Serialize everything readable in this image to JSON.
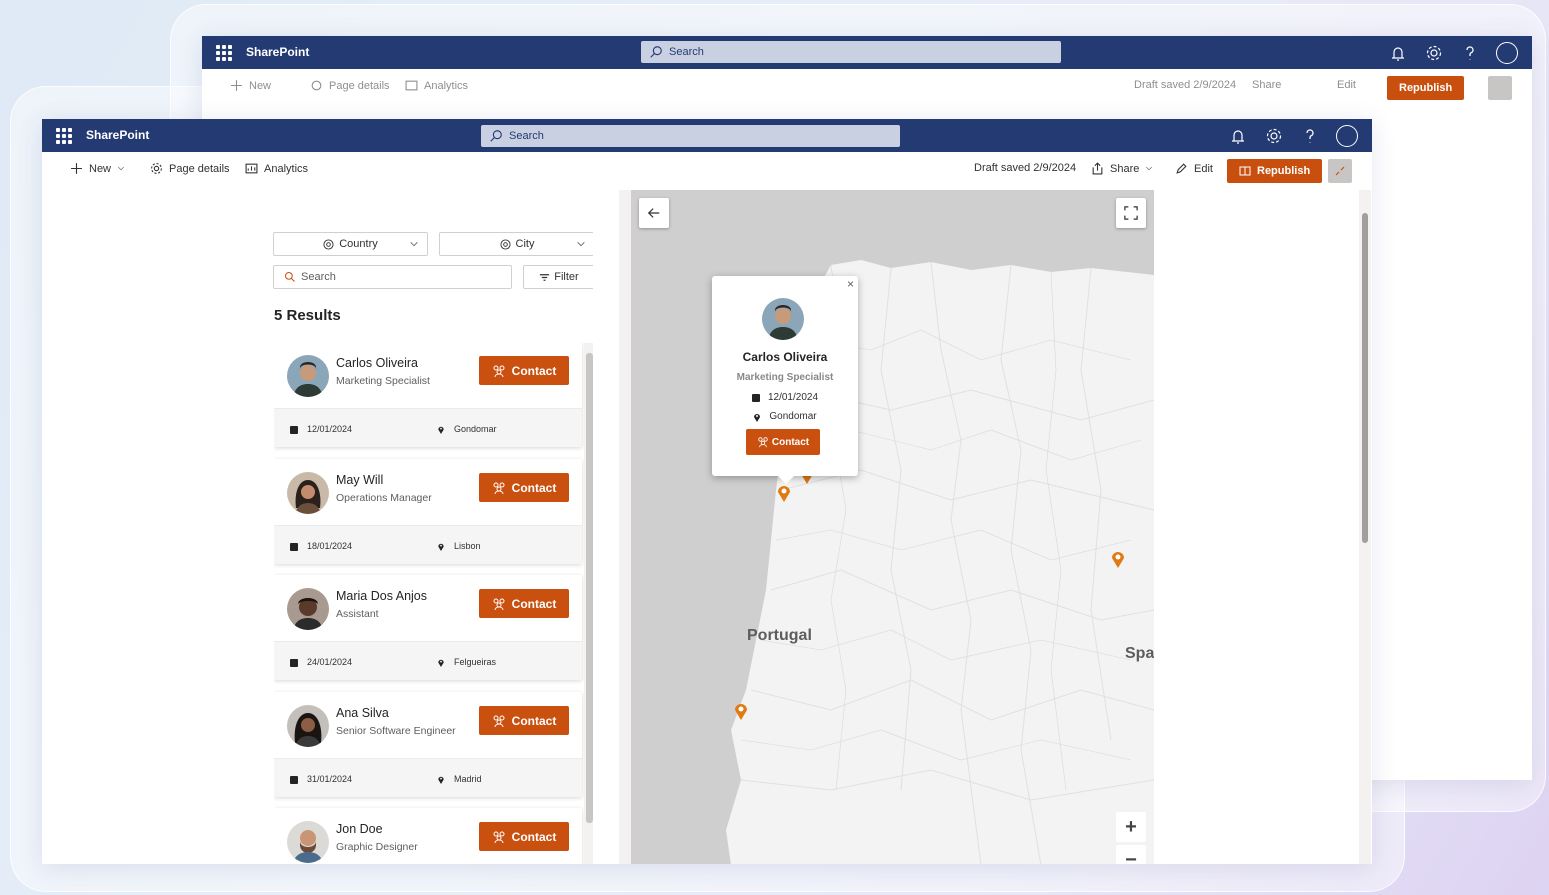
{
  "app": {
    "brand": "SharePoint",
    "search_placeholder": "Search"
  },
  "commandbar": {
    "new_label": "New",
    "page_details_label": "Page details",
    "analytics_label": "Analytics",
    "draft_status": "Draft saved 2/9/2024",
    "share_label": "Share",
    "edit_label": "Edit",
    "republish_label": "Republish"
  },
  "filters": {
    "country_label": "Country",
    "city_label": "City",
    "search_placeholder": "Search",
    "filter_label": "Filter"
  },
  "results_label": "5 Results",
  "people": [
    {
      "name": "Carlos Oliveira",
      "role": "Marketing Specialist",
      "date": "12/01/2024",
      "city": "Gondomar",
      "contact_label": "Contact"
    },
    {
      "name": "May Will",
      "role": "Operations Manager",
      "date": "18/01/2024",
      "city": "Lisbon",
      "contact_label": "Contact"
    },
    {
      "name": "Maria Dos Anjos",
      "role": "Assistant",
      "date": "24/01/2024",
      "city": "Felgueiras",
      "contact_label": "Contact"
    },
    {
      "name": "Ana Silva",
      "role": "Senior Software Engineer",
      "date": "31/01/2024",
      "city": "Madrid",
      "contact_label": "Contact"
    },
    {
      "name": "Jon Doe",
      "role": "Graphic Designer",
      "date": "",
      "city": "",
      "contact_label": "Contact"
    }
  ],
  "map": {
    "label_country": "Portugal",
    "label_partial": "Spa",
    "zoom_in": "+",
    "zoom_out": "−",
    "popup": {
      "name": "Carlos Oliveira",
      "role": "Marketing Specialist",
      "date": "12/01/2024",
      "city": "Gondomar",
      "contact_label": "Contact",
      "close": "×"
    }
  },
  "colors": {
    "suitebar": "#243a73",
    "accent": "#ca5010"
  }
}
